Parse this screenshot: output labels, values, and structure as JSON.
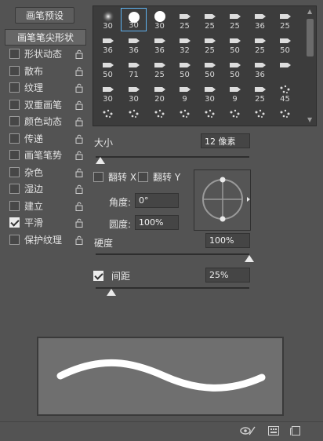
{
  "preset_button": "画笔预设",
  "options": {
    "header": "画笔笔尖形状",
    "items": [
      {
        "label": "形状动态",
        "checked": false
      },
      {
        "label": "散布",
        "checked": false
      },
      {
        "label": "纹理",
        "checked": false
      },
      {
        "label": "双重画笔",
        "checked": false
      },
      {
        "label": "颜色动态",
        "checked": false
      },
      {
        "label": "传递",
        "checked": false
      },
      {
        "label": "画笔笔势",
        "checked": false
      },
      {
        "label": "杂色",
        "checked": false
      },
      {
        "label": "湿边",
        "checked": false
      },
      {
        "label": "建立",
        "checked": false
      },
      {
        "label": "平滑",
        "checked": true
      },
      {
        "label": "保护纹理",
        "checked": false
      }
    ]
  },
  "brush_grid": {
    "selected_index": 1,
    "rows": [
      [
        "30",
        "30",
        "30",
        "25",
        "25",
        "25",
        "36",
        "25"
      ],
      [
        "36",
        "36",
        "36",
        "32",
        "25",
        "50",
        "25",
        "50"
      ],
      [
        "50",
        "71",
        "25",
        "50",
        "50",
        "50",
        "36",
        ""
      ],
      [
        "30",
        "30",
        "20",
        "9",
        "30",
        "9",
        "25",
        "45"
      ],
      [
        "",
        "",
        "",
        "",
        "",
        "",
        "",
        ""
      ]
    ]
  },
  "size": {
    "label": "大小",
    "value": "12 像素",
    "fraction": 0.03
  },
  "flip_x": {
    "label": "翻转 X",
    "checked": false
  },
  "flip_y": {
    "label": "翻转 Y",
    "checked": false
  },
  "angle": {
    "label": "角度:",
    "value": "0°"
  },
  "roundness": {
    "label": "圆度:",
    "value": "100%"
  },
  "hardness": {
    "label": "硬度",
    "value": "100%",
    "fraction": 1.0
  },
  "spacing": {
    "label": "间距",
    "value": "25%",
    "checked": true,
    "fraction": 0.1
  },
  "colors": {
    "selection": "#5fb2f0",
    "panel": "#535353",
    "preview_bg": "#6f6f6f"
  }
}
